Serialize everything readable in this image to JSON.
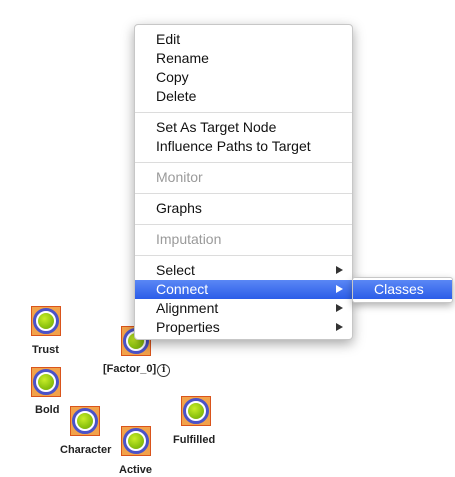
{
  "context_menu": {
    "group1": [
      "Edit",
      "Rename",
      "Copy",
      "Delete"
    ],
    "group2": [
      "Set As Target Node",
      "Influence Paths to Target"
    ],
    "monitor": "Monitor",
    "graphs": "Graphs",
    "imputation": "Imputation",
    "select": "Select",
    "connect": "Connect",
    "alignment": "Alignment",
    "properties": "Properties"
  },
  "submenu": {
    "classes": "Classes"
  },
  "nodes": {
    "trust": "Trust",
    "factor0": "[Factor_0]",
    "factor0_info_icon": "info-icon",
    "bold": "Bold",
    "character": "Character",
    "fulfilled": "Fulfilled",
    "active": "Active"
  },
  "colors": {
    "menu_highlight": "#3d6ff0",
    "node_ring": "#4a52c8",
    "node_core": "#8cc20e",
    "selection_box": "#f2a24a"
  }
}
